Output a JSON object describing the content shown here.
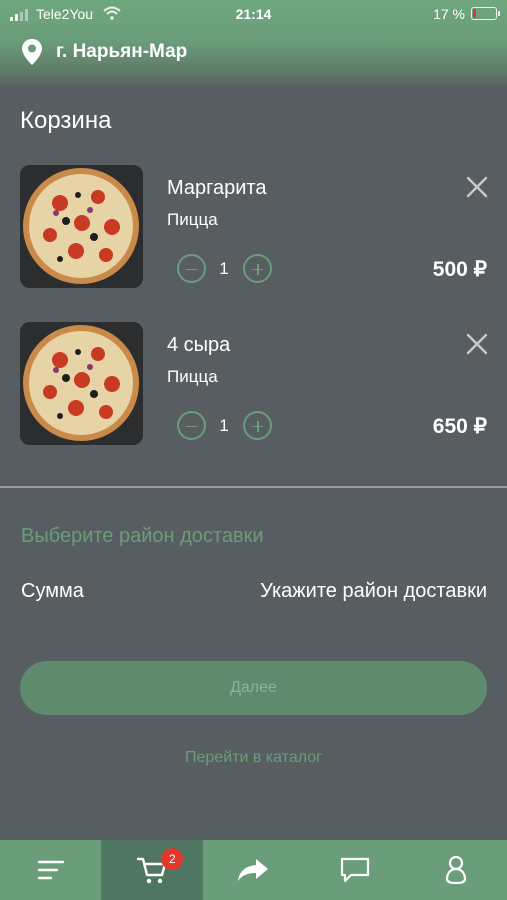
{
  "status_bar": {
    "carrier": "Tele2You",
    "time": "21:14",
    "battery": "17 %",
    "battery_color": "#e0382f"
  },
  "location": {
    "icon": "location-pin-icon",
    "city": "г. Нарьян-Мар"
  },
  "page_title": "Корзина",
  "cart": {
    "items": [
      {
        "name": "Маргарита",
        "category": "Пицца",
        "quantity": "1",
        "price": "500 ₽",
        "image": "pizza-image",
        "remove_icon": "close-icon"
      },
      {
        "name": "4 сыра",
        "category": "Пицца",
        "quantity": "1",
        "price": "650 ₽",
        "image": "pizza-image",
        "remove_icon": "close-icon"
      }
    ]
  },
  "delivery": {
    "district_prompt": "Выберите район доставки",
    "sum_label": "Сумма",
    "sum_value": "Укажите район доставки"
  },
  "actions": {
    "next_label": "Далее",
    "catalog_link": "Перейти в каталог"
  },
  "tab_bar": {
    "tabs": [
      {
        "icon": "menu-icon"
      },
      {
        "icon": "cart-icon",
        "badge": "2",
        "active": true
      },
      {
        "icon": "share-icon"
      },
      {
        "icon": "chat-icon"
      },
      {
        "icon": "profile-icon"
      }
    ]
  },
  "colors": {
    "accent": "#6a9d79",
    "background": "#585d62",
    "badge": "#e0382f"
  }
}
